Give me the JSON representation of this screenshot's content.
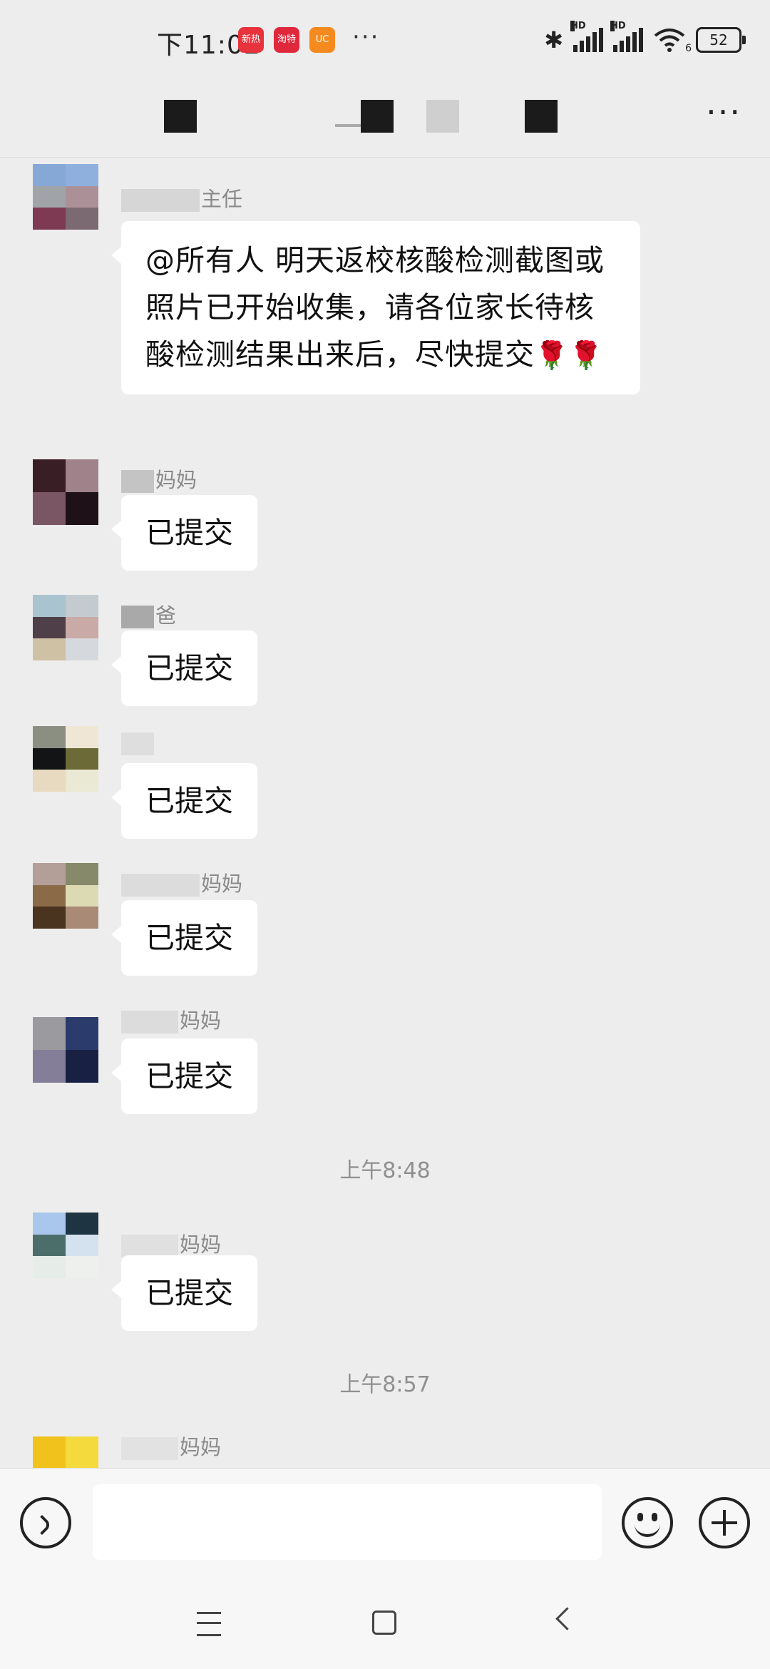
{
  "status_bar": {
    "time": "下11:02",
    "app_badges": [
      {
        "label": "新热",
        "color": "#e8323c"
      },
      {
        "label": "淘特",
        "color": "#e0283c"
      },
      {
        "label": "UC",
        "color": "#f58a1f"
      }
    ],
    "overflow": "···",
    "network_label": "HD",
    "wifi_label": "6",
    "battery": "52"
  },
  "nav": {
    "more": "···"
  },
  "chat": {
    "pinned": {
      "sender": "主任",
      "text": "@所有人  明天返校核酸检测截图或照片已开始收集，请各位家长待核酸检测结果出来后，尽快提交",
      "emoji": "🌹🌹"
    },
    "messages": [
      {
        "sender": "妈妈",
        "text": "已提交"
      },
      {
        "sender": "爸",
        "text": "已提交"
      },
      {
        "sender": "",
        "text": "已提交"
      },
      {
        "sender": "妈妈",
        "text": "已提交"
      },
      {
        "sender": "妈妈",
        "text": "已提交"
      }
    ],
    "time_1": "上午8:48",
    "msg_after_1": {
      "sender": "妈妈",
      "text": "已提交"
    },
    "time_2": "上午8:57",
    "last_sender": "妈妈"
  },
  "input": {
    "placeholder": ""
  }
}
